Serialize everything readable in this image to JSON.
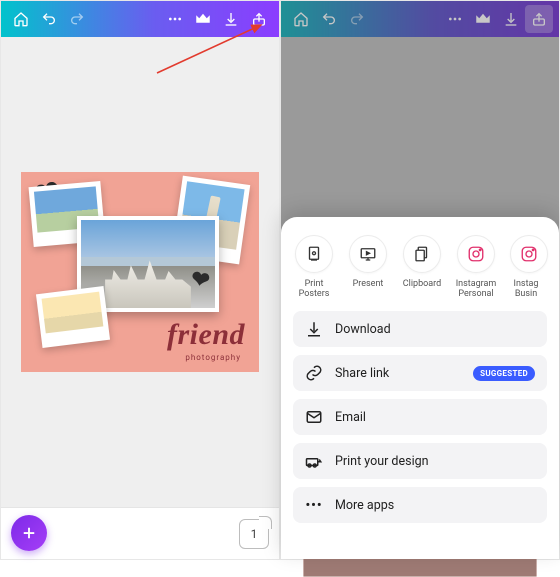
{
  "topbar": {
    "icons": [
      "home-icon",
      "undo-icon",
      "redo-icon",
      "more-icon",
      "crown-icon",
      "download-icon",
      "share-icon"
    ]
  },
  "design": {
    "title": "friend",
    "subtitle": "photography"
  },
  "bottom": {
    "page_count": "1"
  },
  "share": {
    "targets": [
      {
        "name": "print-posters",
        "label": "Print\nPosters",
        "icon": "print-icon"
      },
      {
        "name": "present",
        "label": "Present",
        "icon": "present-icon"
      },
      {
        "name": "clipboard",
        "label": "Clipboard",
        "icon": "clipboard-icon"
      },
      {
        "name": "instagram-personal",
        "label": "Instagram\nPersonal",
        "icon": "instagram-icon"
      },
      {
        "name": "instagram-business",
        "label": "Instag\nBusin",
        "icon": "instagram-icon"
      }
    ],
    "actions": {
      "download": "Download",
      "share_link": "Share link",
      "share_badge": "SUGGESTED",
      "email": "Email",
      "print": "Print your design",
      "more": "More apps"
    }
  },
  "annotation": {
    "points_to": "share-icon"
  }
}
